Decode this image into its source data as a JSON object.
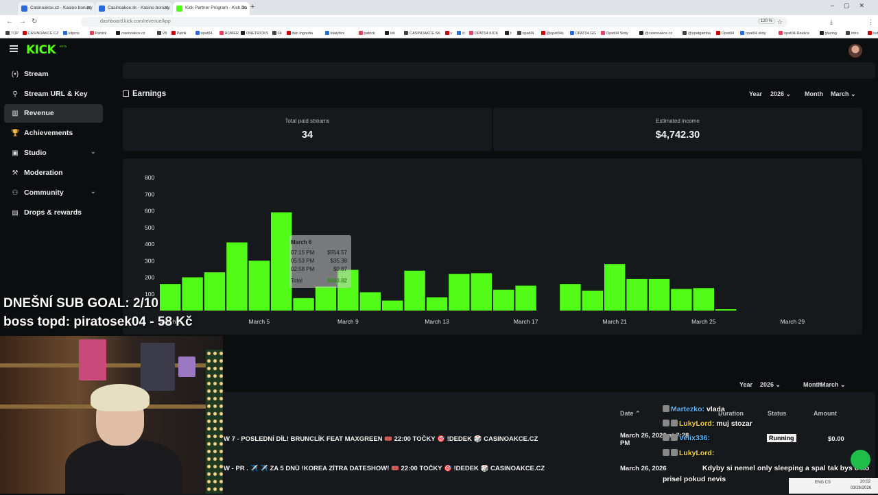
{
  "browser": {
    "tabs": [
      {
        "title": "Casinoakce.cz - Kasino bonusy",
        "color": "#2a6ad9"
      },
      {
        "title": "Casinoakce.sk - Kasino bonusy",
        "color": "#2a6ad9"
      },
      {
        "title": "Kick Partner Program - Kick Da",
        "color": "#53fc18"
      }
    ],
    "url": "dashboard.kick.com/revenue/kpp",
    "zoom": "120 %",
    "bookmarks": [
      "TOP",
      "CASINOAKCE.CZ",
      "kilpros",
      "Patrick",
      "casinoakce.cz",
      "V8",
      "Patrik",
      "opat04",
      "HOMER",
      "ONETRICKS",
      "04",
      "dan Ingredia",
      "lolalytics",
      "patrick",
      "loli",
      "CASINOAKCE.SK",
      "v",
      "d",
      "OPAT04 KICK",
      "t",
      "opat04",
      "@opat04s",
      "OPAT04.GG",
      "Opat04 Sloty",
      "@casinoakce.cz",
      "@opatgamba",
      "Opat04",
      "opat04 sloty",
      "opat04 Reakce",
      "glazing",
      "intro",
      "outro"
    ]
  },
  "app": {
    "logo": "KICK",
    "logo_beta": "BETA",
    "sidebar": [
      {
        "label": "Stream",
        "icon": "(•)"
      },
      {
        "label": "Stream URL & Key",
        "icon": "⚲"
      },
      {
        "label": "Revenue",
        "icon": "▥",
        "active": true
      },
      {
        "label": "Achievements",
        "icon": "🏆"
      },
      {
        "label": "Studio",
        "icon": "▣",
        "chevron": true
      },
      {
        "label": "Moderation",
        "icon": "⚒"
      },
      {
        "label": "Community",
        "icon": "⚇",
        "chevron": true
      },
      {
        "label": "Drops & rewards",
        "icon": "▤"
      }
    ]
  },
  "earnings": {
    "title": "Earnings",
    "year_label": "Year",
    "year_value": "2026",
    "month_label": "Month",
    "month_value": "March",
    "total_paid_label": "Total paid streams",
    "total_paid_value": "34",
    "est_income_label": "Estimated income",
    "est_income_value": "$4,742.30"
  },
  "chart_data": {
    "type": "bar",
    "color": "#53fc18",
    "y_ticks": [
      100,
      200,
      300,
      400,
      500,
      600,
      700,
      800
    ],
    "ylim": [
      0,
      800
    ],
    "x_tick_labels": [
      "March 1",
      "March 5",
      "March 9",
      "March 13",
      "March 17",
      "March 21",
      "March 25",
      "March 29"
    ],
    "categories": [
      "March 1",
      "March 2",
      "March 3",
      "March 4",
      "March 5",
      "March 6",
      "March 7",
      "March 8",
      "March 9",
      "March 10",
      "March 11",
      "March 12",
      "March 13",
      "March 14",
      "March 15",
      "March 16",
      "March 17",
      "March 18",
      "March 19",
      "March 20",
      "March 21",
      "March 22",
      "March 23",
      "March 24",
      "March 25",
      "March 26",
      "March 27",
      "March 28",
      "March 29",
      "March 30",
      "March 31"
    ],
    "values": [
      160,
      200,
      230,
      410,
      300,
      591,
      75,
      145,
      245,
      110,
      60,
      240,
      80,
      220,
      225,
      125,
      150,
      0,
      160,
      120,
      280,
      190,
      190,
      130,
      135,
      8,
      0,
      0,
      0,
      0,
      0
    ]
  },
  "tooltip": {
    "title": "March 6",
    "rows": [
      {
        "time": "07:15 PM",
        "amount": "$554.57"
      },
      {
        "time": "05:53 PM",
        "amount": "$35.38"
      },
      {
        "time": "02:58 PM",
        "amount": "$0.87"
      }
    ],
    "total_label": "Total",
    "total_value": "$590.82"
  },
  "overlay": {
    "goal": "DNEŠNÍ SUB GOAL: 2/10",
    "boss": "boss topd:  piratosek04 - 58 Kč"
  },
  "payouts": {
    "year_label": "Year",
    "year_value": "2026",
    "month_label": "Month",
    "month_value": "March",
    "headers": {
      "date": "Date",
      "duration": "Duration",
      "status": "Status",
      "amount": "Amount"
    },
    "rows": [
      {
        "title": "W 7 - POSLEDNÍ DÍL! BRUNCLÍK FEAT MAXGREEN 🎟️ 22:00 TOČKY 🎯 !DEDEK 🎲 CASINOAKCE.CZ",
        "date": "March 26, 2026 at 7:28 PM",
        "status": "Running",
        "amount": "$0.00"
      },
      {
        "title": "W - PR . ✈️ ✈️ ZA 5 DNŮ !KOREA ZÍTRA DATESHOW! 🎟️ 22:00 TOČKY 🎯 !DEDEK 🎲 CASINOAKCE.CZ",
        "date": "March 26, 2026",
        "status": "",
        "amount": ""
      }
    ]
  },
  "chat": [
    {
      "user": "Martezko:",
      "msg": "vlada",
      "color": "u"
    },
    {
      "user": "LukyLord:",
      "msg": "muj stozar",
      "color": "u2"
    },
    {
      "user": "Velix336:",
      "msg": "",
      "color": "u"
    },
    {
      "user": "LukyLord:",
      "msg": "",
      "color": "u2"
    },
    {
      "user": "",
      "msg": "Kdyby si nemel only sleeping a spal tak bys o ko",
      "color": "u"
    },
    {
      "user": "",
      "msg": "prisel pokud nevis",
      "color": "u"
    }
  ],
  "taskbar": {
    "lang": "ENG CS",
    "time": "20:02",
    "date": "03/26/2026"
  }
}
